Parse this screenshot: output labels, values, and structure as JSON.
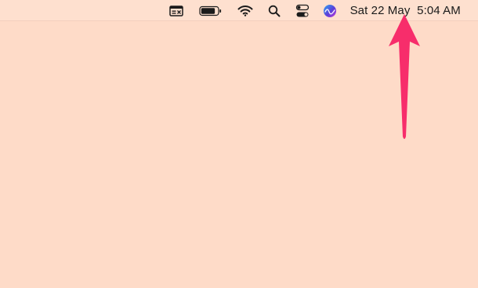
{
  "menubar": {
    "status_items": [
      {
        "icon": "window-display-icon"
      },
      {
        "icon": "battery-icon",
        "level": 0.85
      },
      {
        "icon": "wifi-icon"
      },
      {
        "icon": "spotlight-search-icon"
      },
      {
        "icon": "control-center-icon"
      },
      {
        "icon": "siri-icon"
      }
    ],
    "date": "Sat 22 May",
    "time": "5:04 AM"
  },
  "colors": {
    "desktop": "#fedbc8",
    "menubar": "#fee0cf",
    "annotation_arrow": "#f72d6b",
    "siri_purple": "#5a3fd9",
    "siri_blue": "#2fa7f2"
  }
}
